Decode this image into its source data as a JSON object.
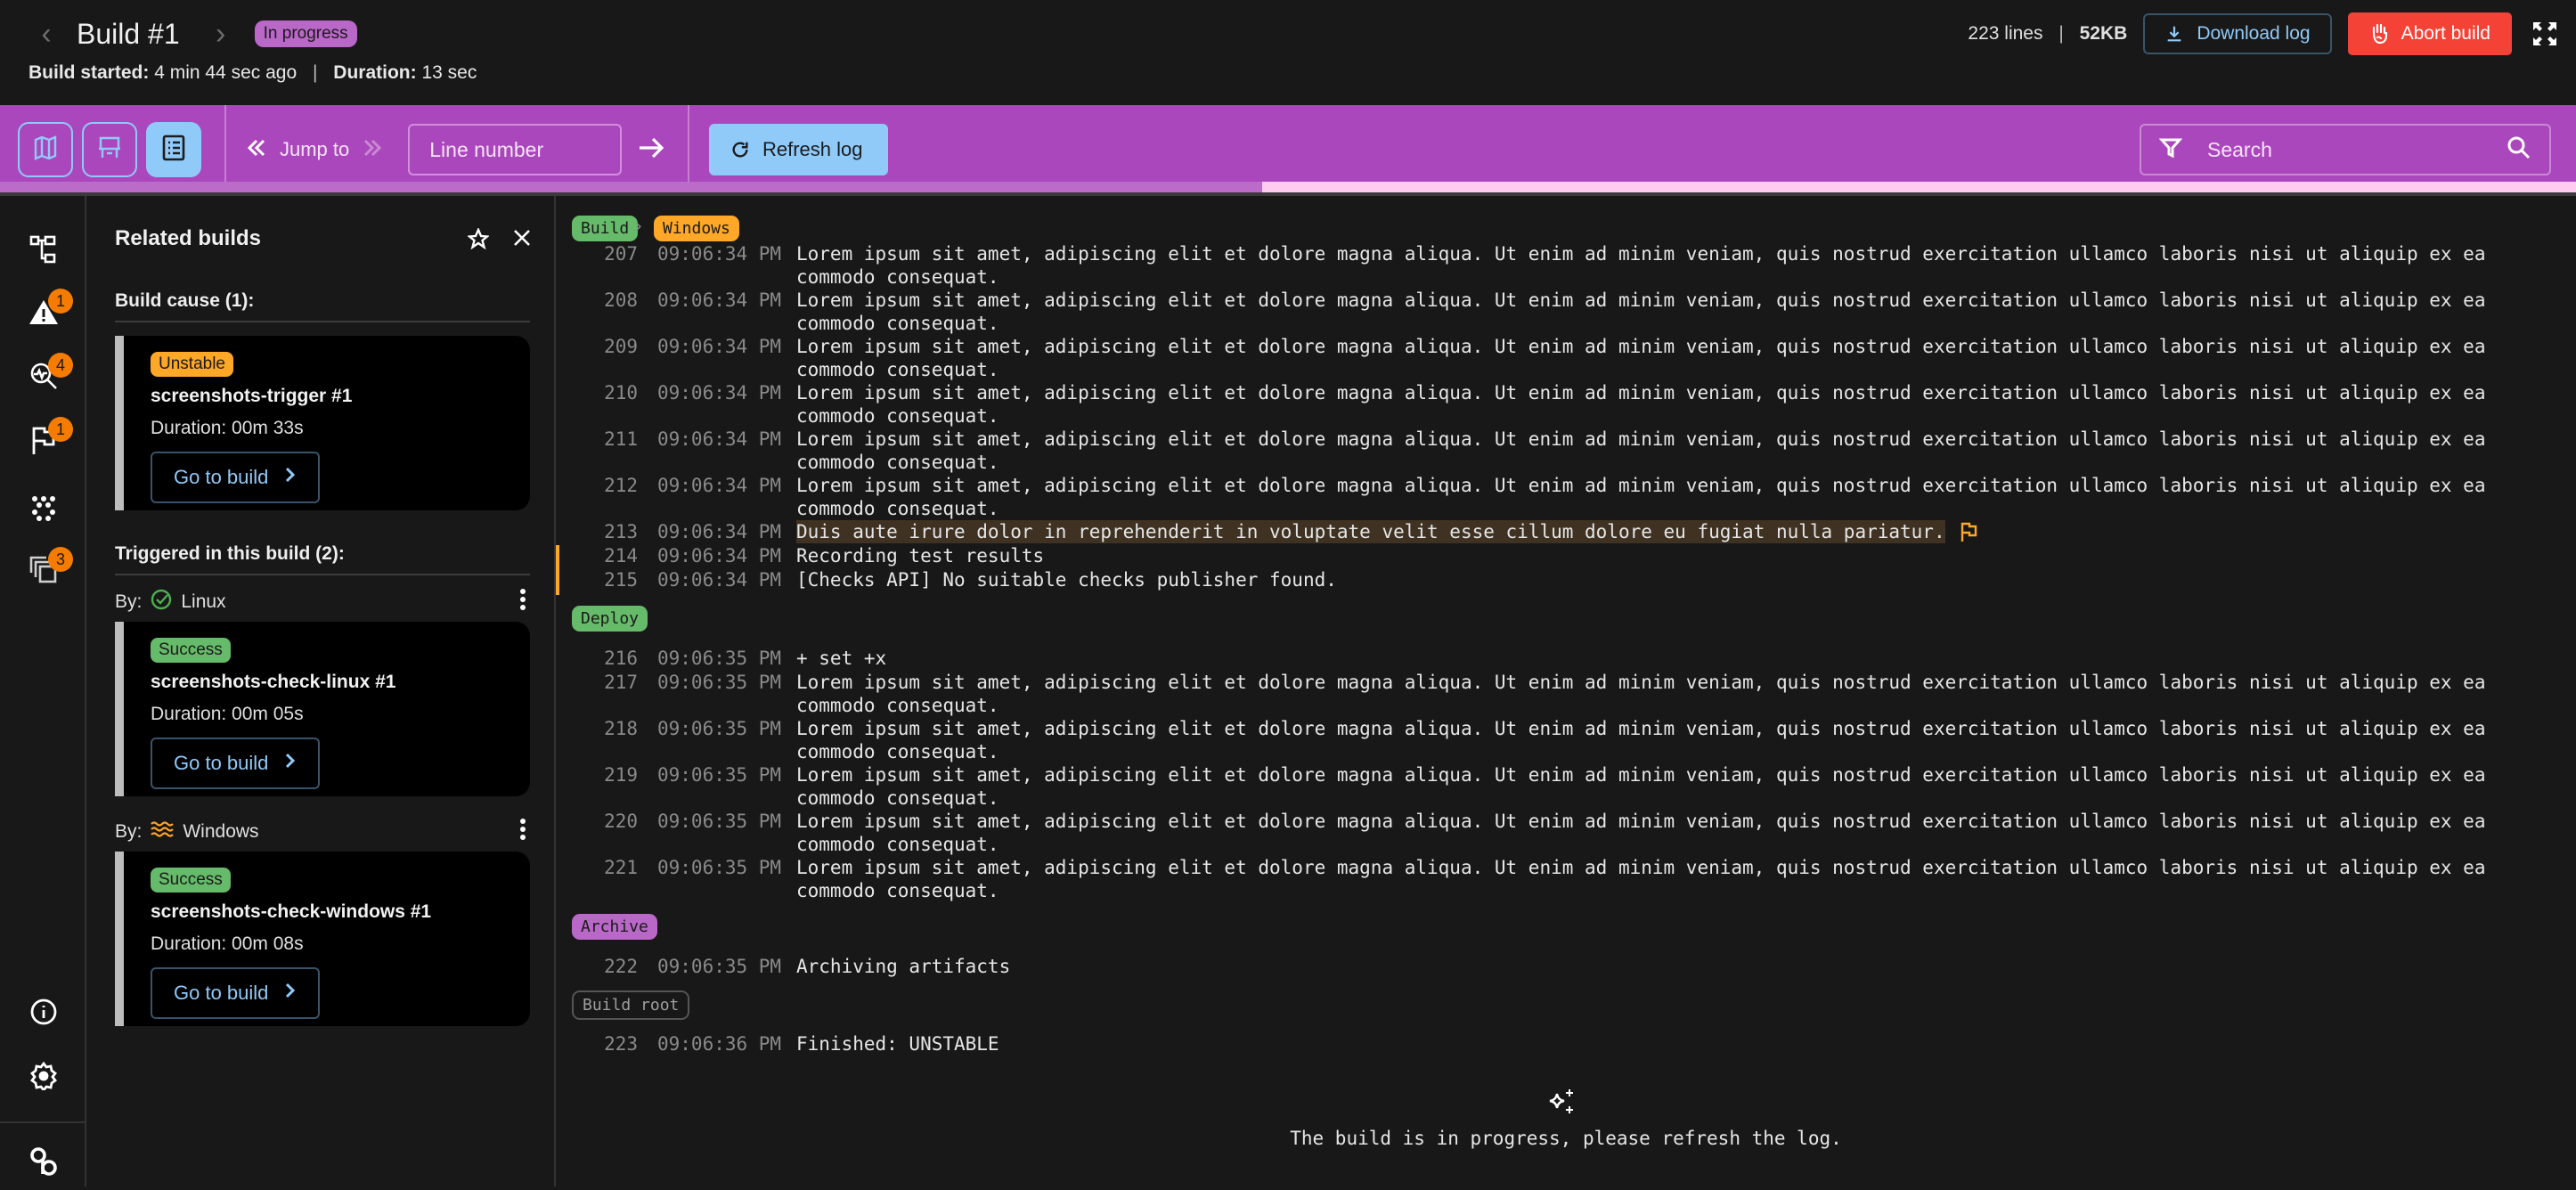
{
  "header": {
    "title": "Build #1",
    "status_badge": "In progress",
    "build_started_label": "Build started:",
    "build_started_value": "4 min 44 sec ago",
    "separator": "|",
    "duration_label": "Duration:",
    "duration_value": "13 sec",
    "lines_count": "223 lines",
    "log_size": "52KB",
    "download_label": "Download log",
    "abort_label": "Abort build",
    "colors": {
      "status_badge": "#ba68c8",
      "abort": "#f44336",
      "download_text": "#90caf9"
    }
  },
  "toolbar": {
    "view_buttons": [
      {
        "icon": "map-icon",
        "active": false
      },
      {
        "icon": "stage-view-icon",
        "active": false
      },
      {
        "icon": "list-view-icon",
        "active": true
      }
    ],
    "jump_to_label": "Jump to",
    "line_number_placeholder": "Line number",
    "refresh_label": "Refresh log",
    "search_placeholder": "Search",
    "scroll_progress_percent": 49,
    "colors": {
      "bar": "#ab47bc",
      "accent": "#90caf9"
    }
  },
  "rail": {
    "items": [
      {
        "icon": "stages-tree-icon",
        "badge": null
      },
      {
        "icon": "warning-icon",
        "badge": "1"
      },
      {
        "icon": "test-analysis-icon",
        "badge": "4"
      },
      {
        "icon": "flag-icon",
        "badge": "1"
      },
      {
        "icon": "dots-pattern-icon",
        "badge": null
      },
      {
        "icon": "related-builds-icon",
        "badge": "3"
      }
    ],
    "bottom": [
      {
        "icon": "info-icon"
      },
      {
        "icon": "settings-icon"
      },
      {
        "icon": "logo-icon"
      }
    ]
  },
  "panel": {
    "title": "Related builds",
    "cause_heading": "Build cause (1):",
    "triggered_heading": "Triggered in this build (2):",
    "by_label": "By:",
    "cause": {
      "status": "Unstable",
      "name": "screenshots-trigger #1",
      "duration": "Duration: 00m 33s",
      "goto_label": "Go to build"
    },
    "triggered": [
      {
        "by": "Linux",
        "by_icon": "check-circle-icon",
        "status": "Success",
        "name": "screenshots-check-linux #1",
        "duration": "Duration: 00m 05s",
        "goto_label": "Go to build"
      },
      {
        "by": "Windows",
        "by_icon": "waves-icon",
        "status": "Success",
        "name": "screenshots-check-windows #1",
        "duration": "Duration: 00m 08s",
        "goto_label": "Go to build"
      }
    ]
  },
  "log": {
    "breadcrumb": [
      "Build",
      "Windows"
    ],
    "lorem": "Lorem ipsum sit amet, adipiscing elit et dolore magna aliqua. Ut enim ad minim veniam, quis nostrud exercitation ullamco laboris nisi ut aliquip ex ea commodo consequat.",
    "section1": [
      {
        "n": "207",
        "t": "09:06:34 PM",
        "text": "Lorem ipsum sit amet, adipiscing elit et dolore magna aliqua. Ut enim ad minim veniam, quis nostrud exercitation ullamco laboris nisi ut aliquip ex ea commodo consequat."
      },
      {
        "n": "208",
        "t": "09:06:34 PM",
        "text": "Lorem ipsum sit amet, adipiscing elit et dolore magna aliqua. Ut enim ad minim veniam, quis nostrud exercitation ullamco laboris nisi ut aliquip ex ea commodo consequat."
      },
      {
        "n": "209",
        "t": "09:06:34 PM",
        "text": "Lorem ipsum sit amet, adipiscing elit et dolore magna aliqua. Ut enim ad minim veniam, quis nostrud exercitation ullamco laboris nisi ut aliquip ex ea commodo consequat."
      },
      {
        "n": "210",
        "t": "09:06:34 PM",
        "text": "Lorem ipsum sit amet, adipiscing elit et dolore magna aliqua. Ut enim ad minim veniam, quis nostrud exercitation ullamco laboris nisi ut aliquip ex ea commodo consequat."
      },
      {
        "n": "211",
        "t": "09:06:34 PM",
        "text": "Lorem ipsum sit amet, adipiscing elit et dolore magna aliqua. Ut enim ad minim veniam, quis nostrud exercitation ullamco laboris nisi ut aliquip ex ea commodo consequat."
      },
      {
        "n": "212",
        "t": "09:06:34 PM",
        "text": "Lorem ipsum sit amet, adipiscing elit et dolore magna aliqua. Ut enim ad minim veniam, quis nostrud exercitation ullamco laboris nisi ut aliquip ex ea commodo consequat."
      },
      {
        "n": "213",
        "t": "09:06:34 PM",
        "text": "Duis aute irure dolor in reprehenderit in voluptate velit esse cillum dolore eu fugiat nulla pariatur.",
        "highlight": true
      },
      {
        "n": "214",
        "t": "09:06:34 PM",
        "text": "Recording test results"
      },
      {
        "n": "215",
        "t": "09:06:34 PM",
        "text": "[Checks API] No suitable checks publisher found."
      }
    ],
    "deploy_chip": "Deploy",
    "section2": [
      {
        "n": "216",
        "t": "09:06:35 PM",
        "text": "+ set +x"
      },
      {
        "n": "217",
        "t": "09:06:35 PM",
        "text": "Lorem ipsum sit amet, adipiscing elit et dolore magna aliqua. Ut enim ad minim veniam, quis nostrud exercitation ullamco laboris nisi ut aliquip ex ea commodo consequat."
      },
      {
        "n": "218",
        "t": "09:06:35 PM",
        "text": "Lorem ipsum sit amet, adipiscing elit et dolore magna aliqua. Ut enim ad minim veniam, quis nostrud exercitation ullamco laboris nisi ut aliquip ex ea commodo consequat."
      },
      {
        "n": "219",
        "t": "09:06:35 PM",
        "text": "Lorem ipsum sit amet, adipiscing elit et dolore magna aliqua. Ut enim ad minim veniam, quis nostrud exercitation ullamco laboris nisi ut aliquip ex ea commodo consequat."
      },
      {
        "n": "220",
        "t": "09:06:35 PM",
        "text": "Lorem ipsum sit amet, adipiscing elit et dolore magna aliqua. Ut enim ad minim veniam, quis nostrud exercitation ullamco laboris nisi ut aliquip ex ea commodo consequat."
      },
      {
        "n": "221",
        "t": "09:06:35 PM",
        "text": "Lorem ipsum sit amet, adipiscing elit et dolore magna aliqua. Ut enim ad minim veniam, quis nostrud exercitation ullamco laboris nisi ut aliquip ex ea commodo consequat."
      }
    ],
    "archive_chip": "Archive",
    "section3": [
      {
        "n": "222",
        "t": "09:06:35 PM",
        "text": "Archiving artifacts"
      }
    ],
    "root_chip": "Build root",
    "section4": [
      {
        "n": "223",
        "t": "09:06:36 PM",
        "text": "Finished: UNSTABLE"
      }
    ],
    "in_progress_message": "The build is in progress, please refresh the log."
  }
}
